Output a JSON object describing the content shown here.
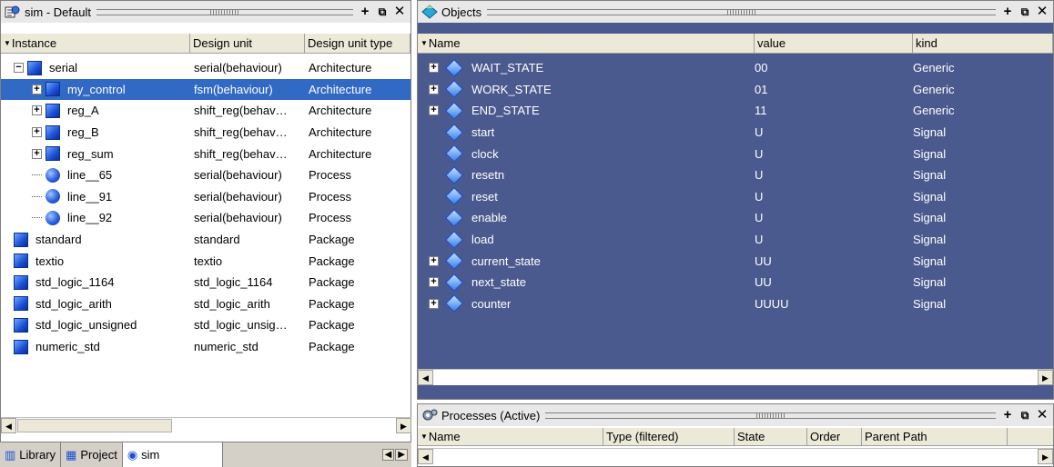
{
  "left_pane": {
    "title": "sim - Default",
    "columns": [
      "Instance",
      "Design unit",
      "Design unit type"
    ],
    "rows": [
      {
        "name": "serial",
        "unit": "serial(behaviour)",
        "type": "Architecture",
        "icon": "architecture-icon",
        "expander": "−",
        "level": 0
      },
      {
        "name": "my_control",
        "unit": "fsm(behaviour)",
        "type": "Architecture",
        "icon": "architecture-icon",
        "expander": "+",
        "level": 1,
        "selected": true
      },
      {
        "name": "reg_A",
        "unit": "shift_reg(behav…",
        "type": "Architecture",
        "icon": "architecture-icon",
        "expander": "+",
        "level": 1
      },
      {
        "name": "reg_B",
        "unit": "shift_reg(behav…",
        "type": "Architecture",
        "icon": "architecture-icon",
        "expander": "+",
        "level": 1
      },
      {
        "name": "reg_sum",
        "unit": "shift_reg(behav…",
        "type": "Architecture",
        "icon": "architecture-icon",
        "expander": "+",
        "level": 1
      },
      {
        "name": "line__65",
        "unit": "serial(behaviour)",
        "type": "Process",
        "icon": "process-icon",
        "expander": "",
        "level": 1
      },
      {
        "name": "line__91",
        "unit": "serial(behaviour)",
        "type": "Process",
        "icon": "process-icon",
        "expander": "",
        "level": 1
      },
      {
        "name": "line__92",
        "unit": "serial(behaviour)",
        "type": "Process",
        "icon": "process-icon",
        "expander": "",
        "level": 1
      },
      {
        "name": "standard",
        "unit": "standard",
        "type": "Package",
        "icon": "package-icon",
        "expander": "",
        "level": 0
      },
      {
        "name": "textio",
        "unit": "textio",
        "type": "Package",
        "icon": "package-icon",
        "expander": "",
        "level": 0
      },
      {
        "name": "std_logic_1164",
        "unit": "std_logic_1164",
        "type": "Package",
        "icon": "package-icon",
        "expander": "",
        "level": 0
      },
      {
        "name": "std_logic_arith",
        "unit": "std_logic_arith",
        "type": "Package",
        "icon": "package-icon",
        "expander": "",
        "level": 0
      },
      {
        "name": "std_logic_unsigned",
        "unit": "std_logic_unsig…",
        "type": "Package",
        "icon": "package-icon",
        "expander": "",
        "level": 0
      },
      {
        "name": "numeric_std",
        "unit": "numeric_std",
        "type": "Package",
        "icon": "package-icon",
        "expander": "",
        "level": 0
      }
    ],
    "tabs": [
      {
        "label": "Library",
        "icon": "library-icon",
        "active": false
      },
      {
        "label": "Project",
        "icon": "project-icon",
        "active": false
      },
      {
        "label": "sim",
        "icon": "sim-icon",
        "active": true
      }
    ]
  },
  "objects_pane": {
    "title": "Objects",
    "columns": [
      "Name",
      "value",
      "kind"
    ],
    "rows": [
      {
        "name": "WAIT_STATE",
        "value": "00",
        "kind": "Generic",
        "expander": "+"
      },
      {
        "name": "WORK_STATE",
        "value": "01",
        "kind": "Generic",
        "expander": "+"
      },
      {
        "name": "END_STATE",
        "value": "11",
        "kind": "Generic",
        "expander": "+"
      },
      {
        "name": "start",
        "value": "U",
        "kind": "Signal",
        "expander": ""
      },
      {
        "name": "clock",
        "value": "U",
        "kind": "Signal",
        "expander": ""
      },
      {
        "name": "resetn",
        "value": "U",
        "kind": "Signal",
        "expander": ""
      },
      {
        "name": "reset",
        "value": "U",
        "kind": "Signal",
        "expander": ""
      },
      {
        "name": "enable",
        "value": "U",
        "kind": "Signal",
        "expander": ""
      },
      {
        "name": "load",
        "value": "U",
        "kind": "Signal",
        "expander": ""
      },
      {
        "name": "current_state",
        "value": "UU",
        "kind": "Signal",
        "expander": "+"
      },
      {
        "name": "next_state",
        "value": "UU",
        "kind": "Signal",
        "expander": "+"
      },
      {
        "name": "counter",
        "value": "UUUU",
        "kind": "Signal",
        "expander": "+"
      }
    ]
  },
  "processes_pane": {
    "title": "Processes (Active)",
    "columns": [
      "Name",
      "Type (filtered)",
      "State",
      "Order",
      "Parent Path"
    ]
  },
  "colors": {
    "selection": "#316ac5",
    "objects_bg": "#4b5a8e",
    "title_bg": "#e8e8e8"
  }
}
